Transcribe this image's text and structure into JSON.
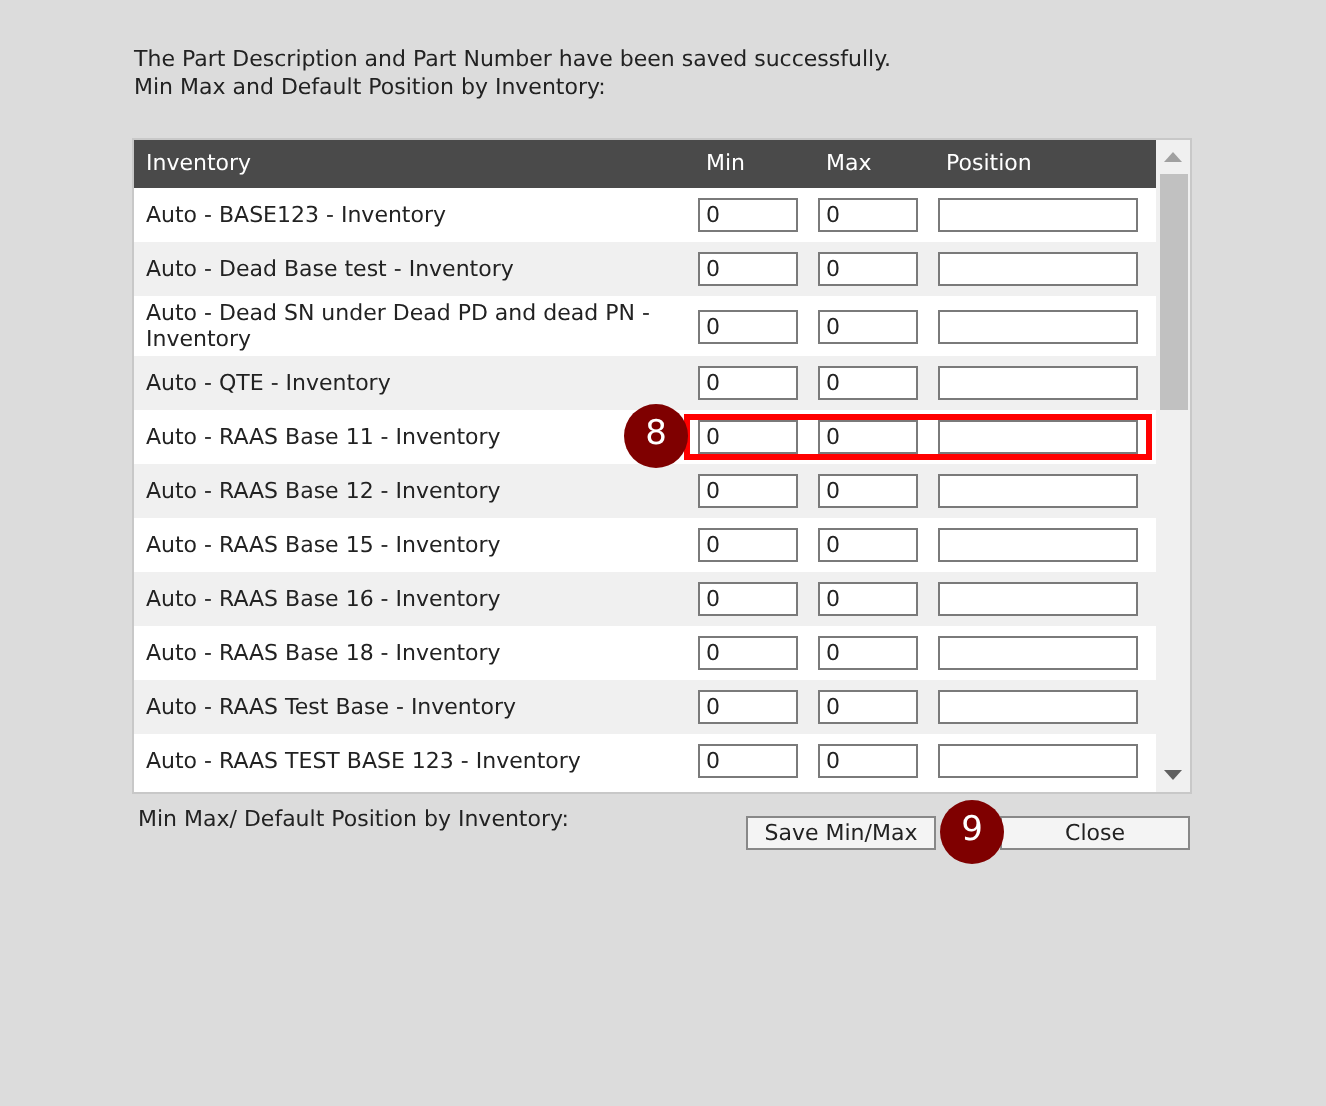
{
  "message": "The Part Description and Part Number have been saved successfully.",
  "subtitle": "Min Max and Default Position by Inventory:",
  "table": {
    "columns": [
      "Inventory",
      "Min",
      "Max",
      "Position"
    ],
    "rows": [
      {
        "inventory": "Auto - BASE123 - Inventory",
        "min": "0",
        "max": "0",
        "highlighted": false
      },
      {
        "inventory": "Auto - Dead Base test - Inventory",
        "min": "0",
        "max": "0",
        "highlighted": false
      },
      {
        "inventory": "Auto - Dead SN under Dead PD and dead PN - Inventory",
        "min": "0",
        "max": "0",
        "highlighted": false
      },
      {
        "inventory": "Auto - QTE - Inventory",
        "min": "0",
        "max": "0",
        "highlighted": false
      },
      {
        "inventory": "Auto - RAAS Base 11 - Inventory",
        "min": "0",
        "max": "0",
        "highlighted": true,
        "callout": "8"
      },
      {
        "inventory": "Auto - RAAS Base 12 - Inventory",
        "min": "0",
        "max": "0",
        "highlighted": false
      },
      {
        "inventory": "Auto - RAAS Base 15 - Inventory",
        "min": "0",
        "max": "0",
        "highlighted": false
      },
      {
        "inventory": "Auto - RAAS Base 16 - Inventory",
        "min": "0",
        "max": "0",
        "highlighted": false
      },
      {
        "inventory": "Auto - RAAS Base 18 - Inventory",
        "min": "0",
        "max": "0",
        "highlighted": false
      },
      {
        "inventory": "Auto - RAAS Test Base - Inventory",
        "min": "0",
        "max": "0",
        "highlighted": false
      },
      {
        "inventory": "Auto - RAAS TEST BASE 123 - Inventory",
        "min": "0",
        "max": "0",
        "highlighted": false
      }
    ]
  },
  "footer_label": "Min Max/ Default Position by Inventory:",
  "buttons": [
    {
      "label": "Save Min/Max",
      "callout": "9"
    },
    {
      "label": "Close"
    }
  ]
}
